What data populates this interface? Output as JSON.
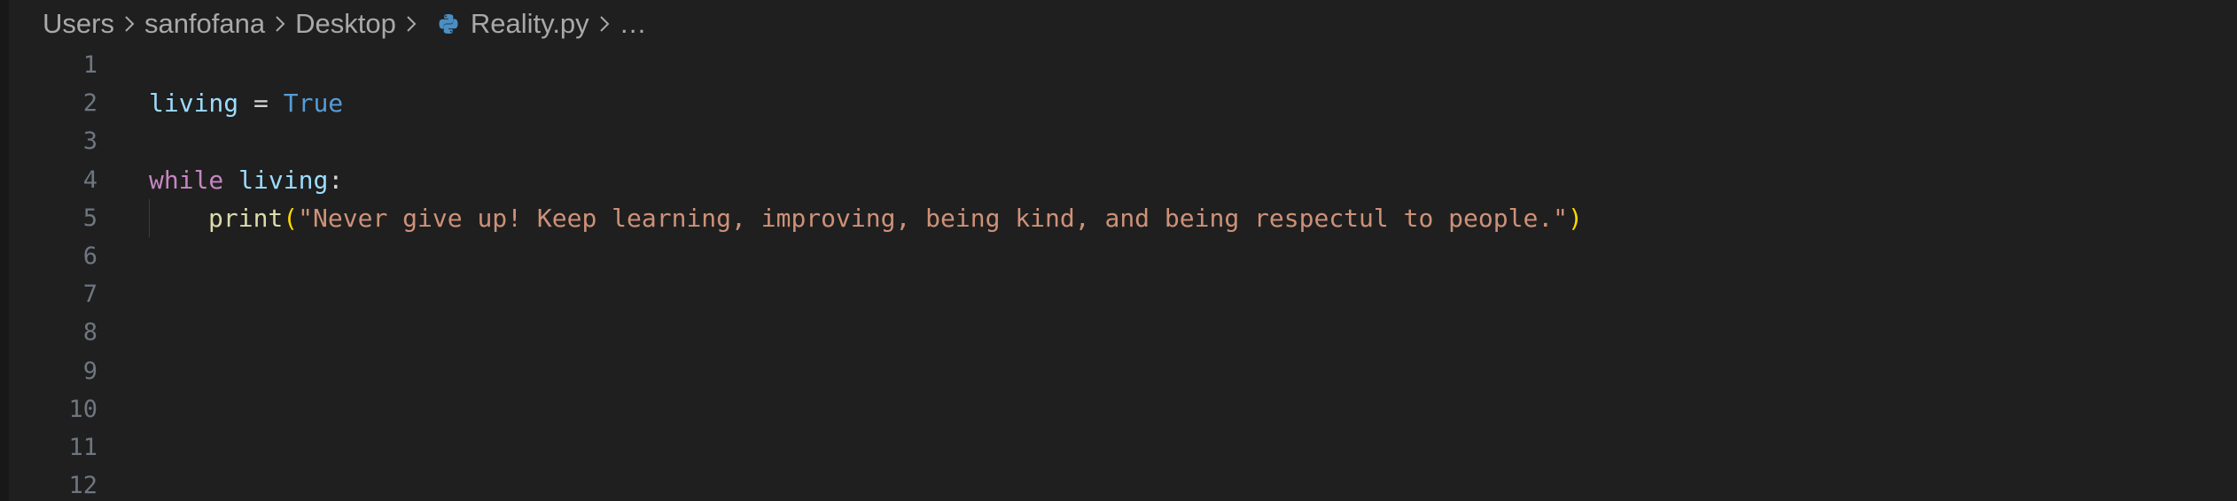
{
  "breadcrumb": {
    "items": [
      "Users",
      "sanfofana",
      "Desktop"
    ],
    "file": "Reality.py",
    "more": "…",
    "separator_icon": "chevron-right-icon",
    "file_icon": "python-icon"
  },
  "editor": {
    "line_numbers": [
      "1",
      "2",
      "3",
      "4",
      "5",
      "6",
      "7",
      "8",
      "9",
      "10",
      "11",
      "12"
    ],
    "lines": {
      "l2": {
        "var": "living",
        "op": " = ",
        "const": "True"
      },
      "l4": {
        "kw": "while",
        "space": " ",
        "var": "living",
        "colon": ":"
      },
      "l5": {
        "fn": "print",
        "open": "(",
        "str": "\"Never give up! Keep learning, improving, being kind, and being respectul to people.\"",
        "close": ")"
      }
    }
  },
  "colors": {
    "background": "#1f1f1f",
    "line_number": "#6e7681",
    "variable": "#9cdcfe",
    "constant": "#569cd6",
    "keyword": "#c586c0",
    "function": "#dcdcaa",
    "string": "#ce9178",
    "bracket": "#ffd700"
  }
}
